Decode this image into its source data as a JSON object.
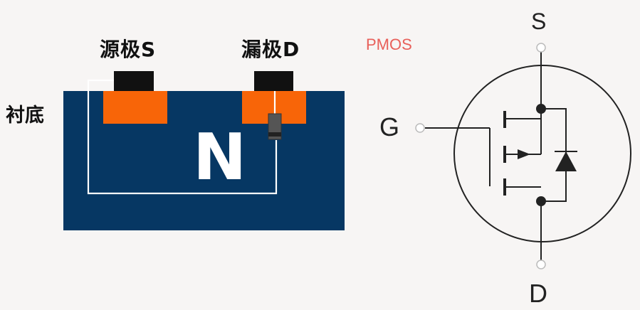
{
  "cross_section": {
    "source_label": "源极S",
    "drain_label": "漏极D",
    "substrate_label": "衬底",
    "well_label": "N"
  },
  "title_label": "PMOS",
  "symbol": {
    "gate_label": "G",
    "source_label": "S",
    "drain_label": "D"
  },
  "colors": {
    "background": "#f7f5f4",
    "substrate": "#063763",
    "diffusion": "#f86508",
    "metal_contact": "#111111",
    "wire_white": "#ffffff",
    "title": "#e8605a",
    "symbol_line": "#222222"
  }
}
